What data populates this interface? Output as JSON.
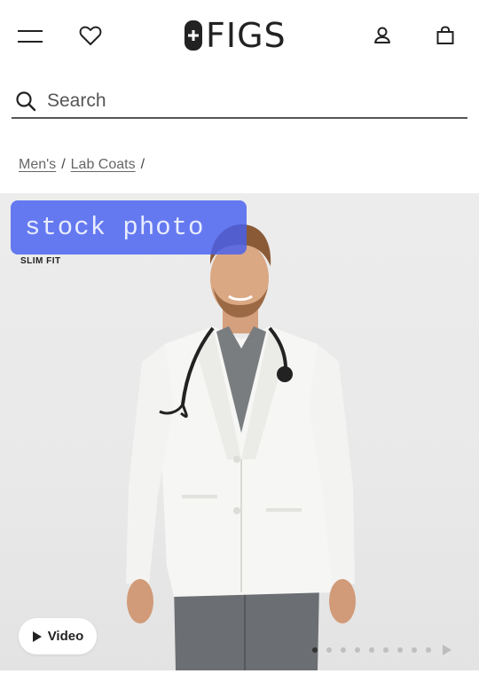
{
  "header": {
    "brand": "FIGS",
    "icons": {
      "menu": "hamburger-menu-icon",
      "wishlist": "heart-icon",
      "account": "user-icon",
      "bag": "shopping-bag-icon"
    }
  },
  "search": {
    "placeholder": "Search",
    "icon": "search-icon"
  },
  "breadcrumb": {
    "items": [
      "Men's",
      "Lab Coats"
    ],
    "separator": "/"
  },
  "product_gallery": {
    "fit_label": "SLIM FIT",
    "overlay_text": "stock photo",
    "video_button_label": "Video",
    "slide_count": 9,
    "active_slide": 1
  },
  "colors": {
    "brand_dark": "#222222",
    "overlay_blue": "#465ff0",
    "hero_background": "#ececec"
  }
}
